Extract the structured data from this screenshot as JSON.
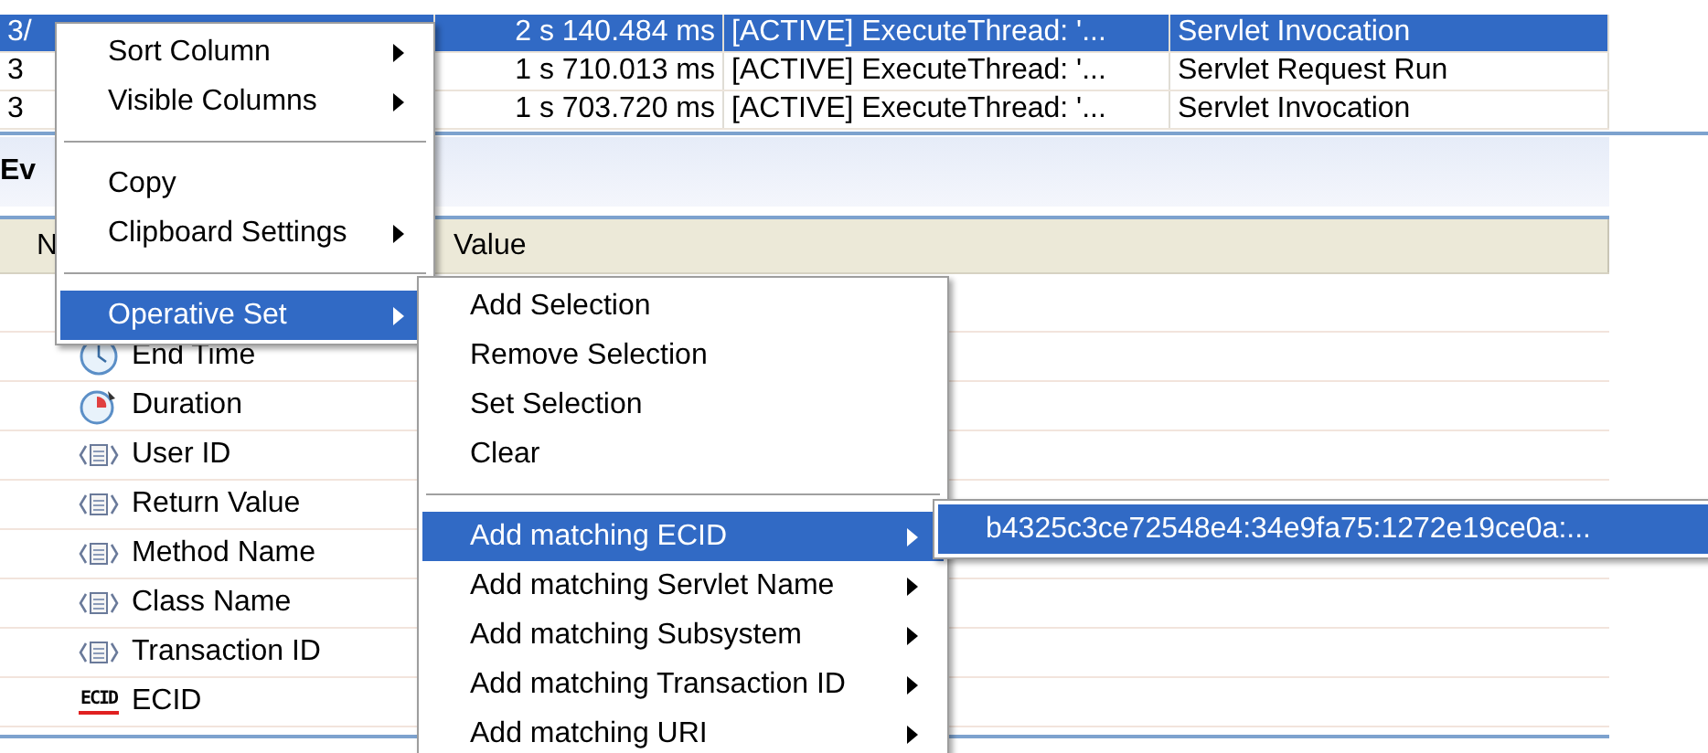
{
  "top_table": {
    "rows": [
      {
        "selected": true,
        "cells": [
          "3/",
          "2 s 140.484 ms",
          "[ACTIVE] ExecuteThread: '...",
          "Servlet Invocation"
        ]
      },
      {
        "selected": false,
        "cells": [
          "3",
          "1 s 710.013 ms",
          "[ACTIVE] ExecuteThread: '...",
          "Servlet Request Run"
        ]
      },
      {
        "selected": false,
        "cells": [
          "3",
          "1 s 703.720 ms",
          "[ACTIVE] ExecuteThread: '...",
          "Servlet Invocation"
        ]
      }
    ]
  },
  "panel": {
    "title": "Ev",
    "columns": [
      "N",
      "Value"
    ],
    "rows": [
      {
        "kind": "clock",
        "name": "End Time"
      },
      {
        "kind": "duration",
        "name": "Duration"
      },
      {
        "kind": "attribute",
        "name": "User ID"
      },
      {
        "kind": "attribute",
        "name": "Return Value"
      },
      {
        "kind": "attribute",
        "name": "Method Name"
      },
      {
        "kind": "attribute",
        "name": "Class Name"
      },
      {
        "kind": "attribute",
        "name": "Transaction ID"
      },
      {
        "kind": "ecid",
        "name": "ECID",
        "icon_text": "ECID"
      }
    ]
  },
  "context_menu": {
    "items": [
      {
        "kind": "item",
        "label": "Sort Column",
        "submenu": true,
        "selected": false
      },
      {
        "kind": "item",
        "label": "Visible Columns",
        "submenu": true,
        "selected": false
      },
      {
        "kind": "separator"
      },
      {
        "kind": "item",
        "label": "Copy",
        "submenu": false,
        "selected": false
      },
      {
        "kind": "item",
        "label": "Clipboard Settings",
        "submenu": true,
        "selected": false
      },
      {
        "kind": "separator"
      },
      {
        "kind": "item",
        "label": "Operative Set",
        "submenu": true,
        "selected": true
      }
    ]
  },
  "operative_set_menu": {
    "items": [
      {
        "kind": "item",
        "label": "Add Selection",
        "submenu": false,
        "selected": false
      },
      {
        "kind": "item",
        "label": "Remove Selection",
        "submenu": false,
        "selected": false
      },
      {
        "kind": "item",
        "label": "Set Selection",
        "submenu": false,
        "selected": false
      },
      {
        "kind": "item",
        "label": "Clear",
        "submenu": false,
        "selected": false
      },
      {
        "kind": "separator"
      },
      {
        "kind": "item",
        "label": "Add matching ECID",
        "submenu": true,
        "selected": true
      },
      {
        "kind": "item",
        "label": "Add matching Servlet Name",
        "submenu": true,
        "selected": false
      },
      {
        "kind": "item",
        "label": "Add matching Subsystem",
        "submenu": true,
        "selected": false
      },
      {
        "kind": "item",
        "label": "Add matching Transaction ID",
        "submenu": true,
        "selected": false
      },
      {
        "kind": "item",
        "label": "Add matching URI",
        "submenu": true,
        "selected": false
      }
    ]
  },
  "ecid_menu": {
    "items": [
      {
        "kind": "item",
        "label": "b4325c3ce72548e4:34e9fa75:1272e19ce0a:...",
        "submenu": false,
        "selected": true
      }
    ]
  }
}
